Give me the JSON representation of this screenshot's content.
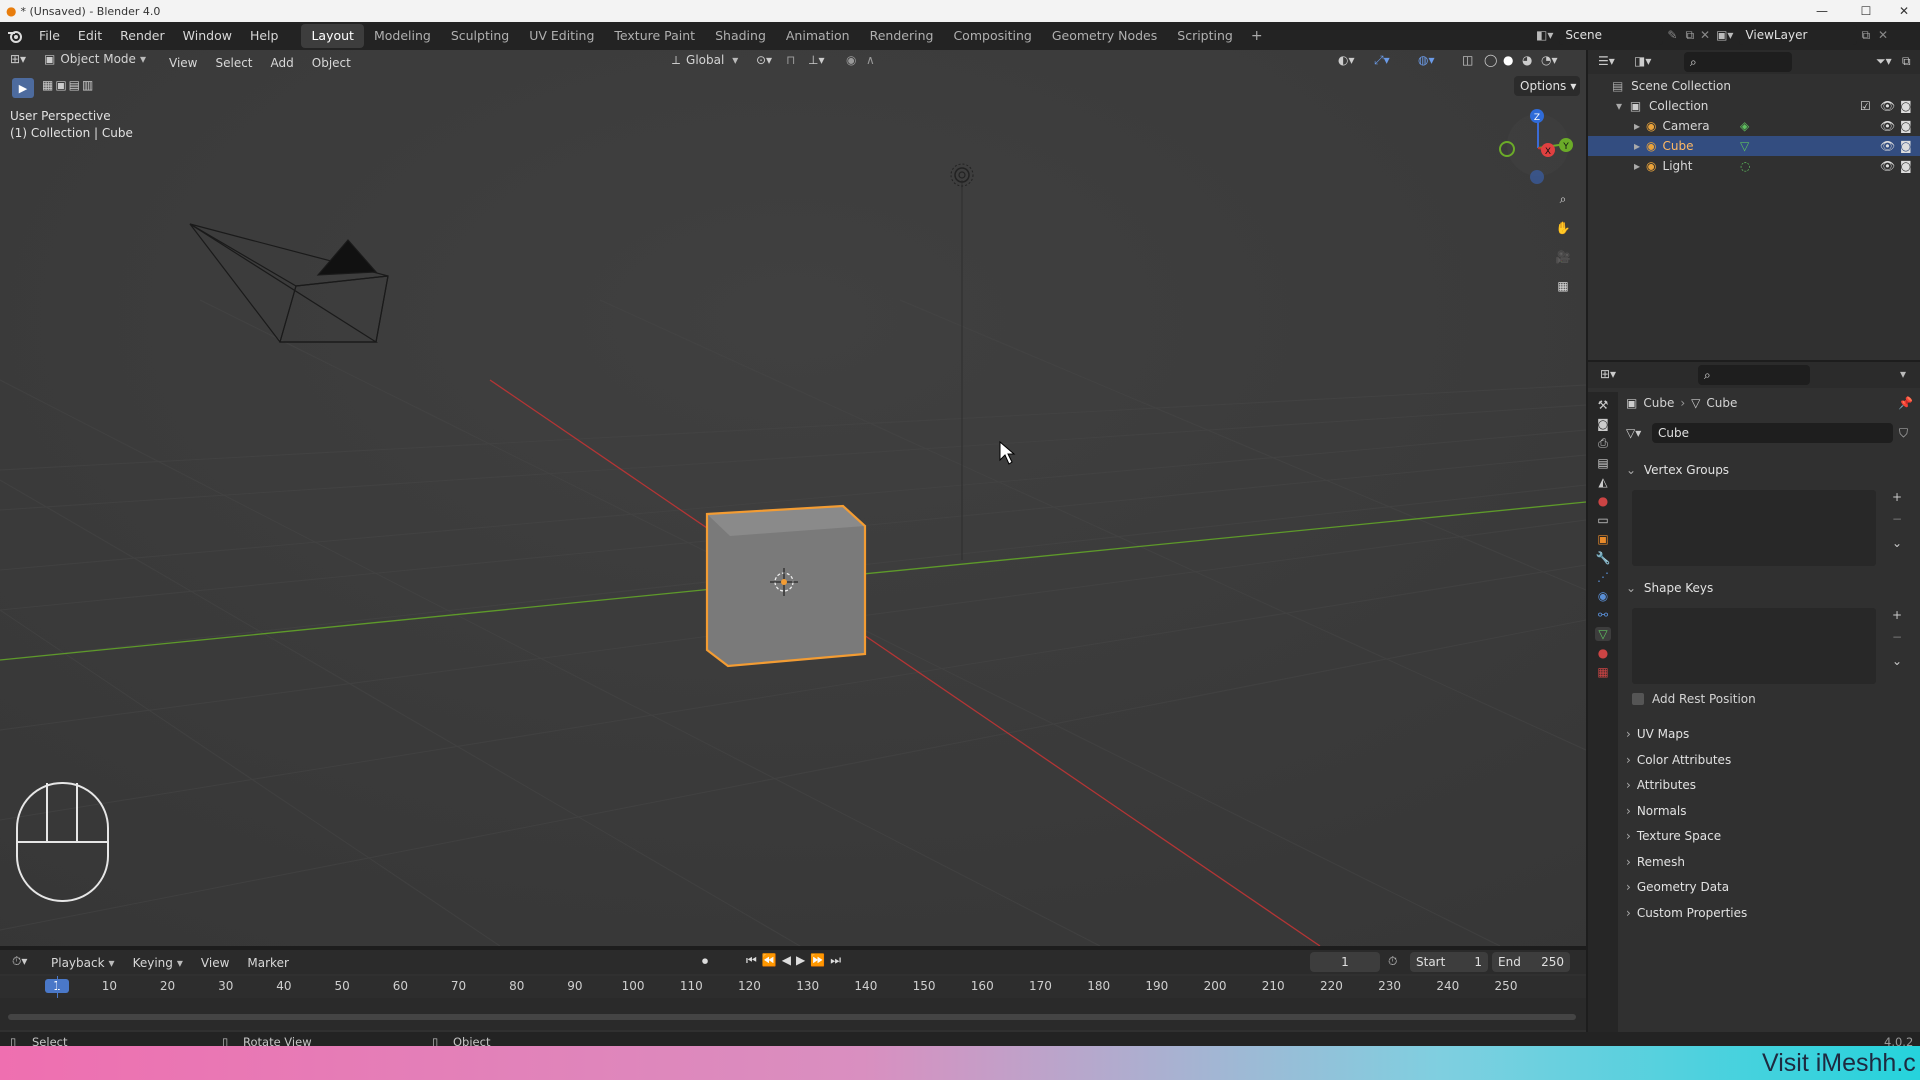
{
  "window": {
    "title": "* (Unsaved) - Blender 4.0"
  },
  "menus": [
    "File",
    "Edit",
    "Render",
    "Window",
    "Help"
  ],
  "workspaces": [
    {
      "label": "Layout",
      "active": true
    },
    {
      "label": "Modeling"
    },
    {
      "label": "Sculpting"
    },
    {
      "label": "UV Editing"
    },
    {
      "label": "Texture Paint"
    },
    {
      "label": "Shading"
    },
    {
      "label": "Animation"
    },
    {
      "label": "Rendering"
    },
    {
      "label": "Compositing"
    },
    {
      "label": "Geometry Nodes"
    },
    {
      "label": "Scripting"
    }
  ],
  "scene": {
    "name": "Scene",
    "view_layer": "ViewLayer"
  },
  "viewport_header": {
    "mode": "Object Mode",
    "menus": [
      "View",
      "Select",
      "Add",
      "Object"
    ],
    "transform_orientation": "Global",
    "options": "Options"
  },
  "viewport": {
    "perspective_label": "User Perspective",
    "collection_label": "(1) Collection | Cube"
  },
  "outliner": {
    "root": "Scene Collection",
    "collection": "Collection",
    "items": [
      {
        "name": "Camera",
        "selected": false
      },
      {
        "name": "Cube",
        "selected": true
      },
      {
        "name": "Light",
        "selected": false
      }
    ]
  },
  "properties": {
    "breadcrumb_object": "Cube",
    "breadcrumb_data": "Cube",
    "data_name": "Cube",
    "panels_open": [
      "Vertex Groups",
      "Shape Keys"
    ],
    "add_rest_position": "Add Rest Position",
    "panels_closed": [
      "UV Maps",
      "Color Attributes",
      "Attributes",
      "Normals",
      "Texture Space",
      "Remesh",
      "Geometry Data",
      "Custom Properties"
    ]
  },
  "timeline": {
    "menus": [
      "Playback",
      "Keying",
      "View",
      "Marker"
    ],
    "current_frame": "1",
    "start_label": "Start",
    "start": "1",
    "end_label": "End",
    "end": "250",
    "ticks": [
      "1",
      "10",
      "20",
      "30",
      "40",
      "50",
      "60",
      "70",
      "80",
      "90",
      "100",
      "110",
      "120",
      "130",
      "140",
      "150",
      "160",
      "170",
      "180",
      "190",
      "200",
      "210",
      "220",
      "230",
      "240",
      "250"
    ]
  },
  "statusbar": {
    "select": "Select",
    "rotate": "Rotate View",
    "object": "Object",
    "version": "4.0.2"
  },
  "banner": {
    "text": "Visit iMeshh.c"
  },
  "colors": {
    "selection_orange": "#f39c33",
    "outliner_selected": "#334d80",
    "x_axis": "#c83232",
    "y_axis": "#6bab28"
  }
}
